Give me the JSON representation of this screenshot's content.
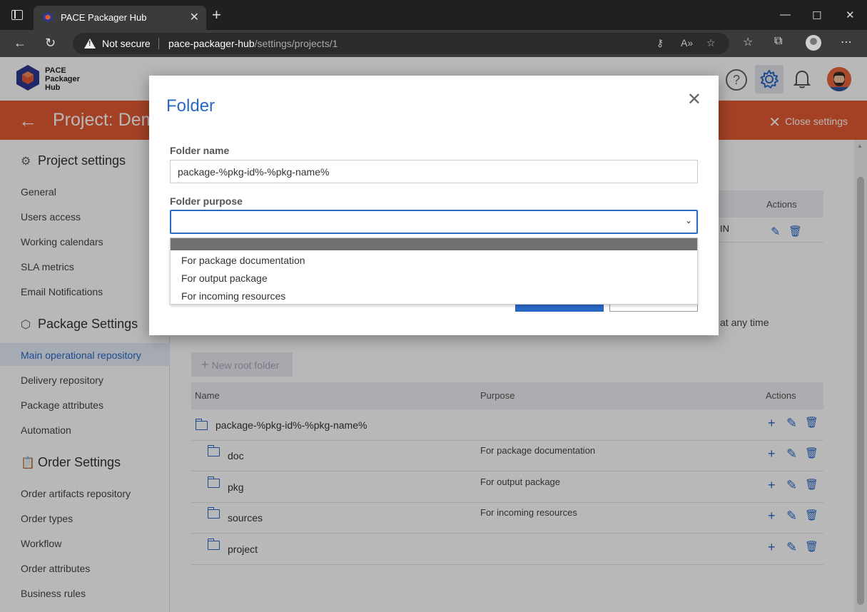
{
  "browser": {
    "tab_title": "PACE Packager Hub",
    "security_label": "Not secure",
    "url_host": "pace-packager-hub",
    "url_path": "/settings/projects/1"
  },
  "app": {
    "logo_text_1": "PACE",
    "logo_text_2": "Packager",
    "logo_text_3": "Hub",
    "help_icon_glyph": "?",
    "page_title": "Project: Dem",
    "close_settings": "Close settings"
  },
  "sidebar": {
    "project_settings": {
      "heading": "Project settings",
      "items": [
        "General",
        "Users access",
        "Working calendars",
        "SLA metrics",
        "Email Notifications"
      ]
    },
    "package_settings": {
      "heading": "Package Settings",
      "items": [
        "Main operational repository",
        "Delivery repository",
        "Package attributes",
        "Automation"
      ]
    },
    "order_settings": {
      "heading": "Order Settings",
      "items": [
        "Order artifacts repository",
        "Order types",
        "Workflow",
        "Order attributes",
        "Business rules"
      ]
    }
  },
  "main": {
    "top_table_actions_header": "Actions",
    "top_row_partial": "IN",
    "partial_text": "at any time",
    "new_root_folder": "New root folder",
    "columns": {
      "name": "Name",
      "purpose": "Purpose",
      "actions": "Actions"
    },
    "rows": [
      {
        "name": "package-%pkg-id%-%pkg-name%",
        "purpose": ""
      },
      {
        "name": "doc",
        "purpose": "For package documentation"
      },
      {
        "name": "pkg",
        "purpose": "For output package"
      },
      {
        "name": "sources",
        "purpose": "For incoming resources"
      },
      {
        "name": "project",
        "purpose": ""
      }
    ]
  },
  "modal": {
    "title": "Folder",
    "folder_name_label": "Folder name",
    "folder_name_value": "package-%pkg-id%-%pkg-name%",
    "folder_purpose_label": "Folder purpose",
    "options": [
      "",
      "For package documentation",
      "For output package",
      "For incoming resources"
    ]
  },
  "colors": {
    "accent": "#2a68c5",
    "header_orange": "#e45b33"
  }
}
